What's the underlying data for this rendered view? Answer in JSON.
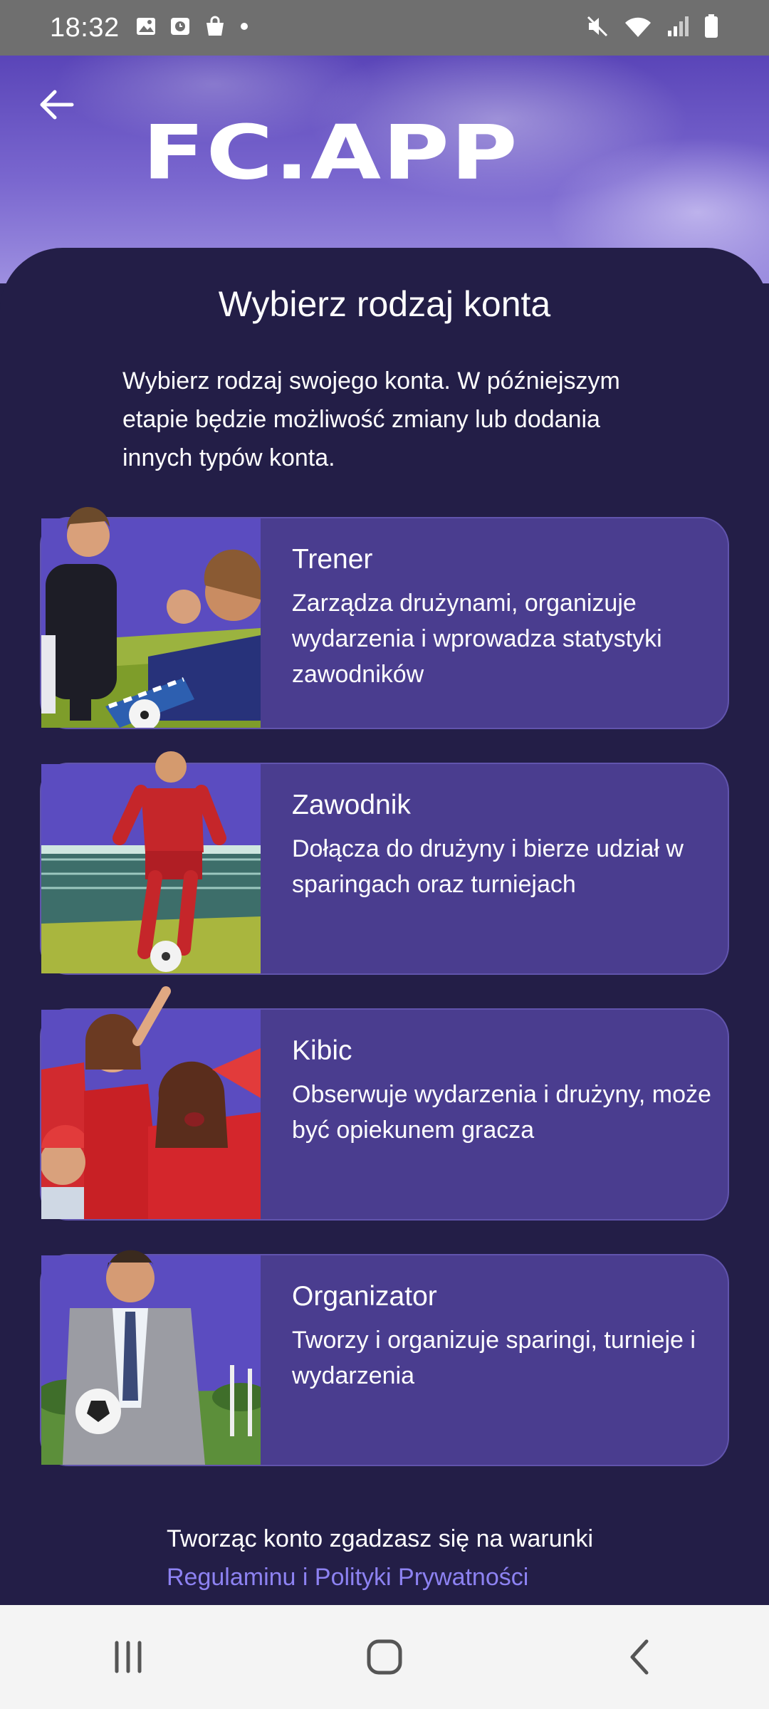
{
  "status_bar": {
    "time": "18:32",
    "left_icons": [
      "gallery-icon",
      "clock-app-icon",
      "shopping-bag-icon",
      "dot-icon"
    ],
    "right_icons": [
      "mute-icon",
      "wifi-icon",
      "signal-icon",
      "battery-icon"
    ]
  },
  "header": {
    "logo_text": "FC.APP",
    "back_icon": "arrow-left-icon"
  },
  "page": {
    "title": "Wybierz rodzaj konta",
    "subtitle": "Wybierz rodzaj swojego konta. W późniejszym etapie będzie możliwość zmiany lub dodania innych typów konta."
  },
  "account_types": [
    {
      "name": "Trener",
      "description": "Zarządza drużynami, organizuje wydarzenia i wprowadza statystyki zawodników"
    },
    {
      "name": "Zawodnik",
      "description": "Dołącza do drużyny i bierze udział w sparingach oraz turniejach"
    },
    {
      "name": "Kibic",
      "description": "Obserwuje wydarzenia i drużyny, może być opiekunem gracza"
    },
    {
      "name": "Organizator",
      "description": "Tworzy i organizuje sparingi, turnieje i wydarzenia"
    }
  ],
  "terms": {
    "text": "Tworząc konto zgadzasz się na warunki",
    "link": "Regulaminu i Polityki Prywatności"
  },
  "nav_bar": {
    "icons": [
      "recent-apps-icon",
      "home-icon",
      "back-icon"
    ]
  },
  "colors": {
    "background": "#231e47",
    "card": "#4a3d8f",
    "accent_link": "#8d82f2",
    "header": "#6a55c4"
  }
}
